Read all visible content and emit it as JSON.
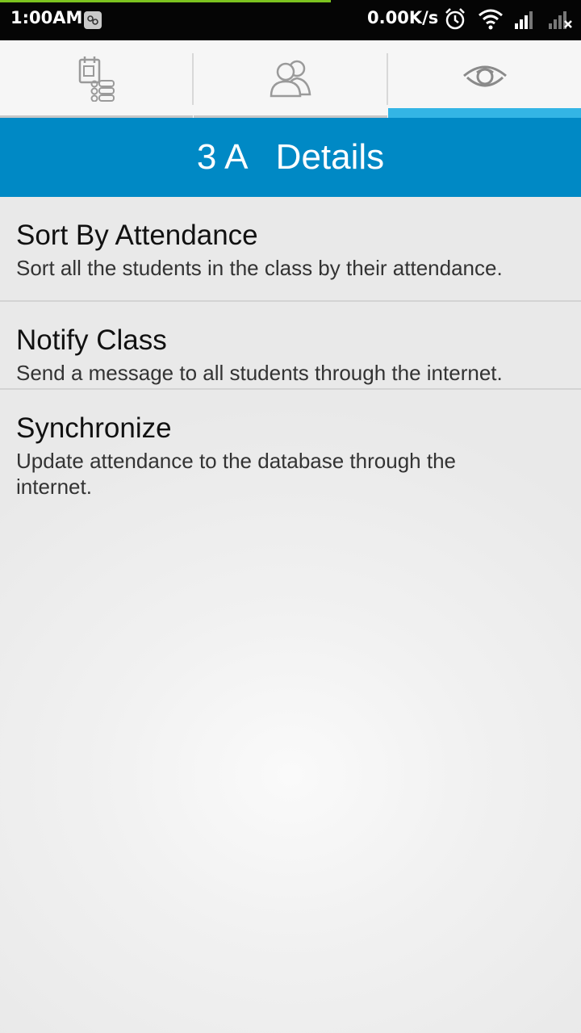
{
  "status_bar": {
    "time": "1:00AM",
    "speed": "0.00K/s",
    "icons": [
      "app-notification-icon",
      "alarm-clock-icon",
      "wifi-icon",
      "signal-icon",
      "signal-no-service-icon"
    ]
  },
  "tabs": [
    {
      "name": "class-list",
      "icon": "notebook-list-icon",
      "active": false
    },
    {
      "name": "students",
      "icon": "people-group-icon",
      "active": false
    },
    {
      "name": "details",
      "icon": "eye-icon",
      "active": true
    }
  ],
  "header": {
    "title": "3 A   Details"
  },
  "menu": {
    "items": [
      {
        "title": "Sort By Attendance",
        "description": "Sort all the students in the class by their attendance."
      },
      {
        "title": "Notify Class",
        "description": "Send a message to all students through the internet."
      },
      {
        "title": "Synchronize",
        "description": "Update attendance to the database through the internet."
      }
    ]
  },
  "colors": {
    "header_bg": "#0089c5",
    "active_tab_indicator": "#33b5e5",
    "status_progress": "#7cc31f"
  }
}
